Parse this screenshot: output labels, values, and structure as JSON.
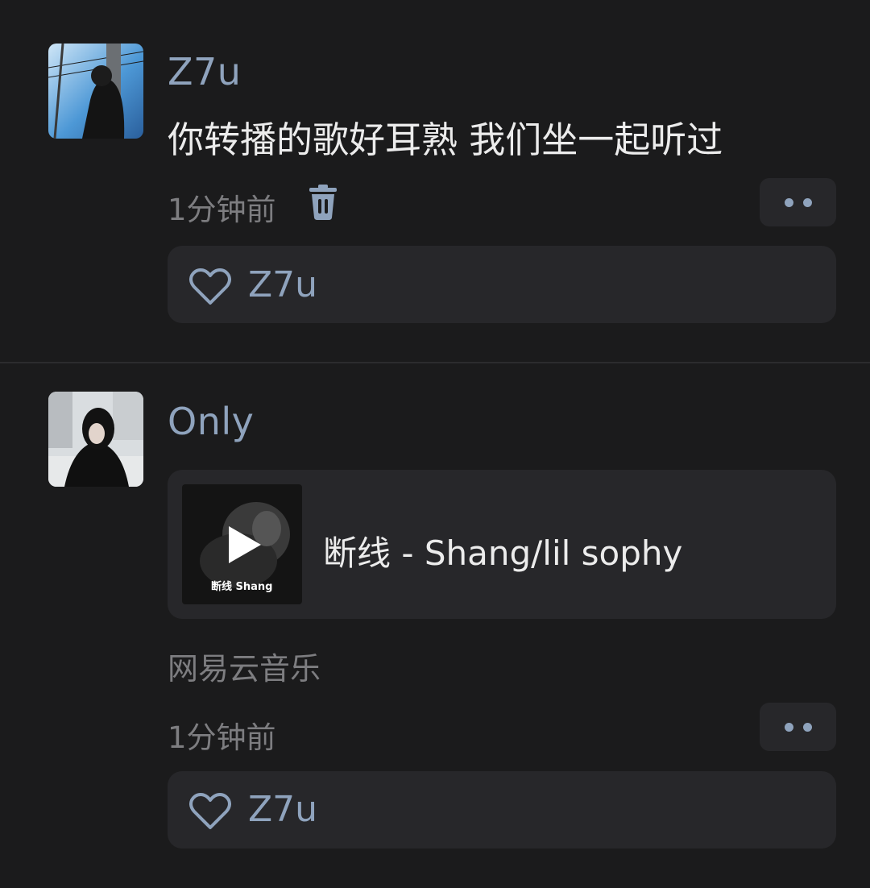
{
  "posts": [
    {
      "username": "Z7u",
      "text": "你转播的歌好耳熟 我们坐一起听过",
      "time": "1分钟前",
      "likes": [
        "Z7u"
      ]
    },
    {
      "username": "Only",
      "song": {
        "title": "断线 - Shang/lil sophy",
        "cover_text": "断线 Shang"
      },
      "source": "网易云音乐",
      "time": "1分钟前",
      "likes": [
        "Z7u"
      ]
    }
  ],
  "colors": {
    "background": "#1b1b1c",
    "card": "#27272a",
    "accent": "#8fa3bd",
    "muted": "#7d7d80"
  },
  "icons": {
    "delete": "trash-icon",
    "more": "more-dots-icon",
    "like": "heart-outline-icon",
    "play": "play-icon"
  }
}
